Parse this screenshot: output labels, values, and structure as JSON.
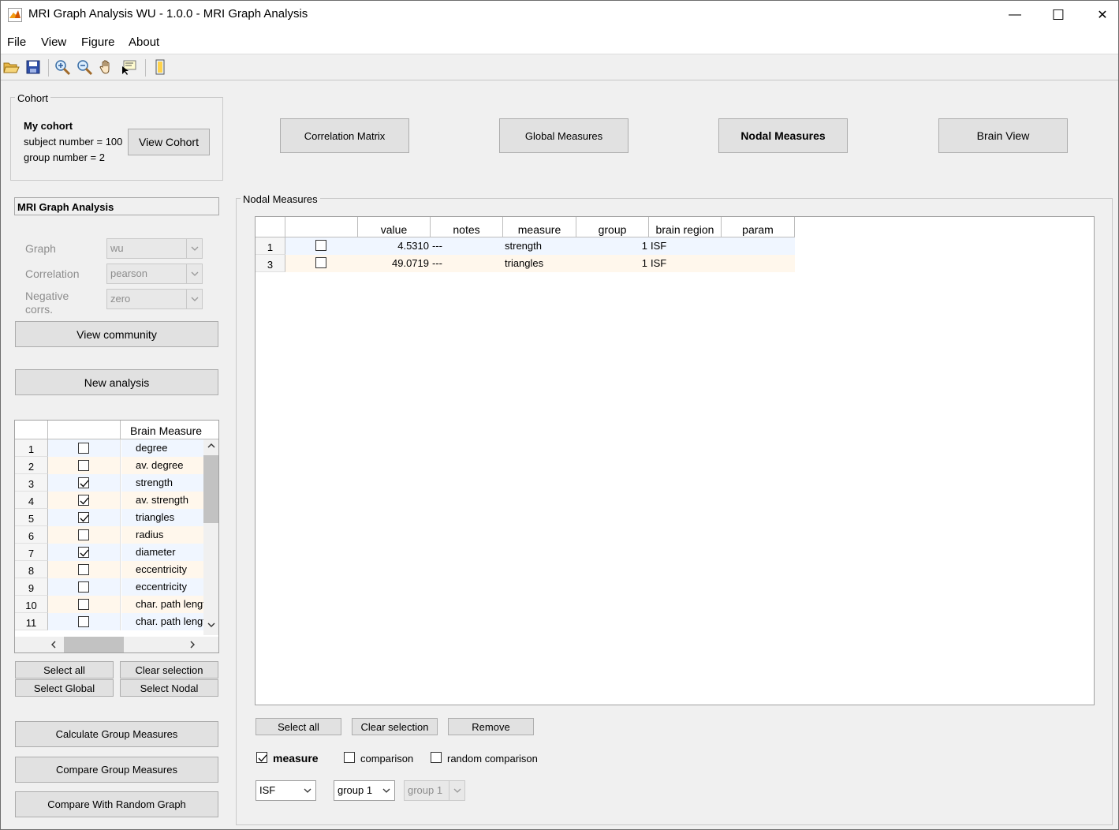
{
  "window": {
    "title": "MRI Graph Analysis WU - 1.0.0 - MRI Graph Analysis",
    "minimize": "—",
    "maximize": "☐",
    "close": "✕"
  },
  "menu": [
    "File",
    "View",
    "Figure",
    "About"
  ],
  "toolbar": {
    "icons": [
      "open-icon",
      "save-icon",
      "zoom-in-icon",
      "zoom-out-icon",
      "pan-icon",
      "data-cursor-icon",
      "colorbar-icon"
    ]
  },
  "cohort": {
    "group_title": "Cohort",
    "name": "My cohort",
    "subject_number": "subject number = 100",
    "group_number": "group number = 2",
    "view_button": "View Cohort"
  },
  "top_buttons": {
    "correlation_matrix": "Correlation Matrix",
    "global_measures": "Global Measures",
    "nodal_measures": "Nodal Measures",
    "brain_view": "Brain View"
  },
  "analysis": {
    "name": "MRI Graph Analysis",
    "graph_label": "Graph",
    "graph_value": "wu",
    "correlation_label": "Correlation",
    "correlation_value": "pearson",
    "negative_label_1": "Negative",
    "negative_label_2": "corrs.",
    "negative_value": "zero",
    "view_community": "View community",
    "new_analysis": "New analysis"
  },
  "measures_table": {
    "header": "Brain Measure",
    "rows": [
      {
        "num": "1",
        "checked": false,
        "name": "degree"
      },
      {
        "num": "2",
        "checked": false,
        "name": "av. degree"
      },
      {
        "num": "3",
        "checked": true,
        "name": "strength"
      },
      {
        "num": "4",
        "checked": true,
        "name": "av. strength"
      },
      {
        "num": "5",
        "checked": true,
        "name": "triangles"
      },
      {
        "num": "6",
        "checked": false,
        "name": "radius"
      },
      {
        "num": "7",
        "checked": true,
        "name": "diameter"
      },
      {
        "num": "8",
        "checked": false,
        "name": "eccentricity"
      },
      {
        "num": "9",
        "checked": false,
        "name": "eccentricity"
      },
      {
        "num": "10",
        "checked": false,
        "name": "char. path length"
      },
      {
        "num": "11",
        "checked": false,
        "name": "char. path length"
      }
    ]
  },
  "left_buttons": {
    "select_all": "Select all",
    "clear_selection": "Clear selection",
    "select_global": "Select Global",
    "select_nodal": "Select Nodal",
    "calculate": "Calculate Group Measures",
    "compare": "Compare Group Measures",
    "compare_random": "Compare With Random Graph"
  },
  "nodal_panel": {
    "title": "Nodal Measures",
    "headers": [
      "value",
      "notes",
      "measure",
      "group",
      "brain region",
      "param"
    ],
    "rows": [
      {
        "num": "1",
        "checked": false,
        "value": "4.5310",
        "notes": "---",
        "measure": "strength",
        "group": "1",
        "region": "ISF",
        "param": ""
      },
      {
        "num": "3",
        "checked": false,
        "value": "49.0719",
        "notes": "---",
        "measure": "triangles",
        "group": "1",
        "region": "ISF",
        "param": ""
      }
    ],
    "select_all": "Select all",
    "clear_selection": "Clear selection",
    "remove": "Remove",
    "measure_label": "measure",
    "measure_checked": true,
    "comparison_label": "comparison",
    "comparison_checked": false,
    "random_comparison_label": "random comparison",
    "random_checked": false,
    "region_select": "ISF",
    "group_select": "group 1",
    "group2_select": "group 1"
  }
}
